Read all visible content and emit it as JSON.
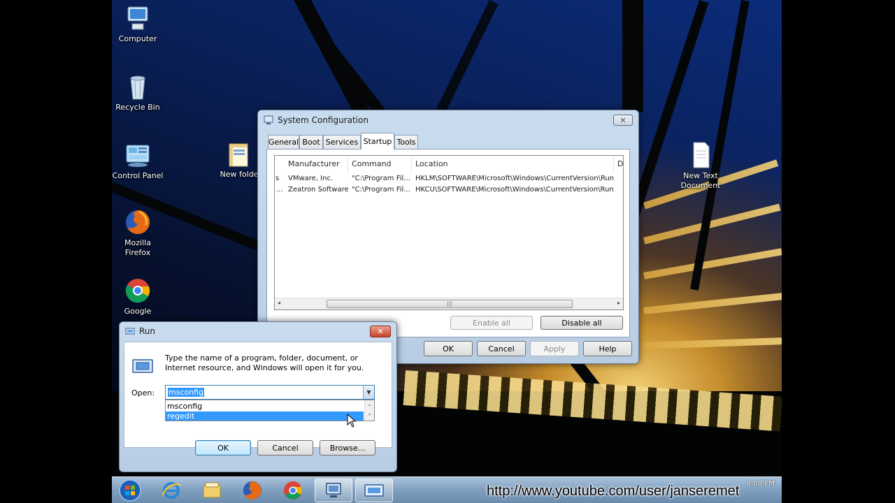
{
  "desktop": {
    "icons": [
      {
        "label_lines": [
          "Computer"
        ],
        "icon": "computer-icon"
      },
      {
        "label_lines": [
          "Recycle Bin"
        ],
        "icon": "recycle-bin-icon"
      },
      {
        "label_lines": [
          "Control Panel"
        ],
        "icon": "control-panel-icon"
      },
      {
        "label_lines": [
          "Mozilla",
          "Firefox"
        ],
        "icon": "firefox-icon"
      },
      {
        "label_lines": [
          "Google"
        ],
        "icon": "chrome-icon"
      },
      {
        "label_lines": [
          "New folde"
        ],
        "icon": "folder-icon"
      },
      {
        "label_lines": [
          "New Text",
          "Document"
        ],
        "icon": "text-document-icon"
      }
    ]
  },
  "sysconfig": {
    "title": "System Configuration",
    "tabs": [
      "General",
      "Boot",
      "Services",
      "Startup",
      "Tools"
    ],
    "active_tab": "Startup",
    "columns": [
      "Manufacturer",
      "Command",
      "Location",
      "D"
    ],
    "rows": [
      {
        "prefix": "s",
        "manufacturer": "VMware, Inc.",
        "command": "\"C:\\Program Fil...",
        "location": "HKLM\\SOFTWARE\\Microsoft\\Windows\\CurrentVersion\\Run"
      },
      {
        "prefix": "...",
        "manufacturer": "Zeatron Software",
        "command": "\"C:\\Program Fil...",
        "location": "HKCU\\SOFTWARE\\Microsoft\\Windows\\CurrentVersion\\Run"
      }
    ],
    "enable_all": "Enable all",
    "disable_all": "Disable all",
    "buttons": {
      "ok": "OK",
      "cancel": "Cancel",
      "apply": "Apply",
      "help": "Help"
    }
  },
  "run": {
    "title": "Run",
    "description": "Type the name of a program, folder, document, or Internet resource, and Windows will open it for you.",
    "open_label": "Open:",
    "input_value": "msconfig",
    "suggestions": [
      "msconfig",
      "regedit"
    ],
    "highlighted_suggestion": "regedit",
    "buttons": {
      "ok": "OK",
      "cancel": "Cancel",
      "browse": "Browse..."
    }
  },
  "taskbar": {
    "items": [
      "start-orb-icon",
      "internet-explorer-icon",
      "windows-explorer-icon",
      "firefox-icon",
      "chrome-icon",
      "system-configuration-icon",
      "run-icon"
    ],
    "clock": "8:08 PM"
  },
  "watermark": "http://www.youtube.com/user/janseremet",
  "colors": {
    "selection": "#3399ff",
    "accent": "#1e6fcf"
  }
}
